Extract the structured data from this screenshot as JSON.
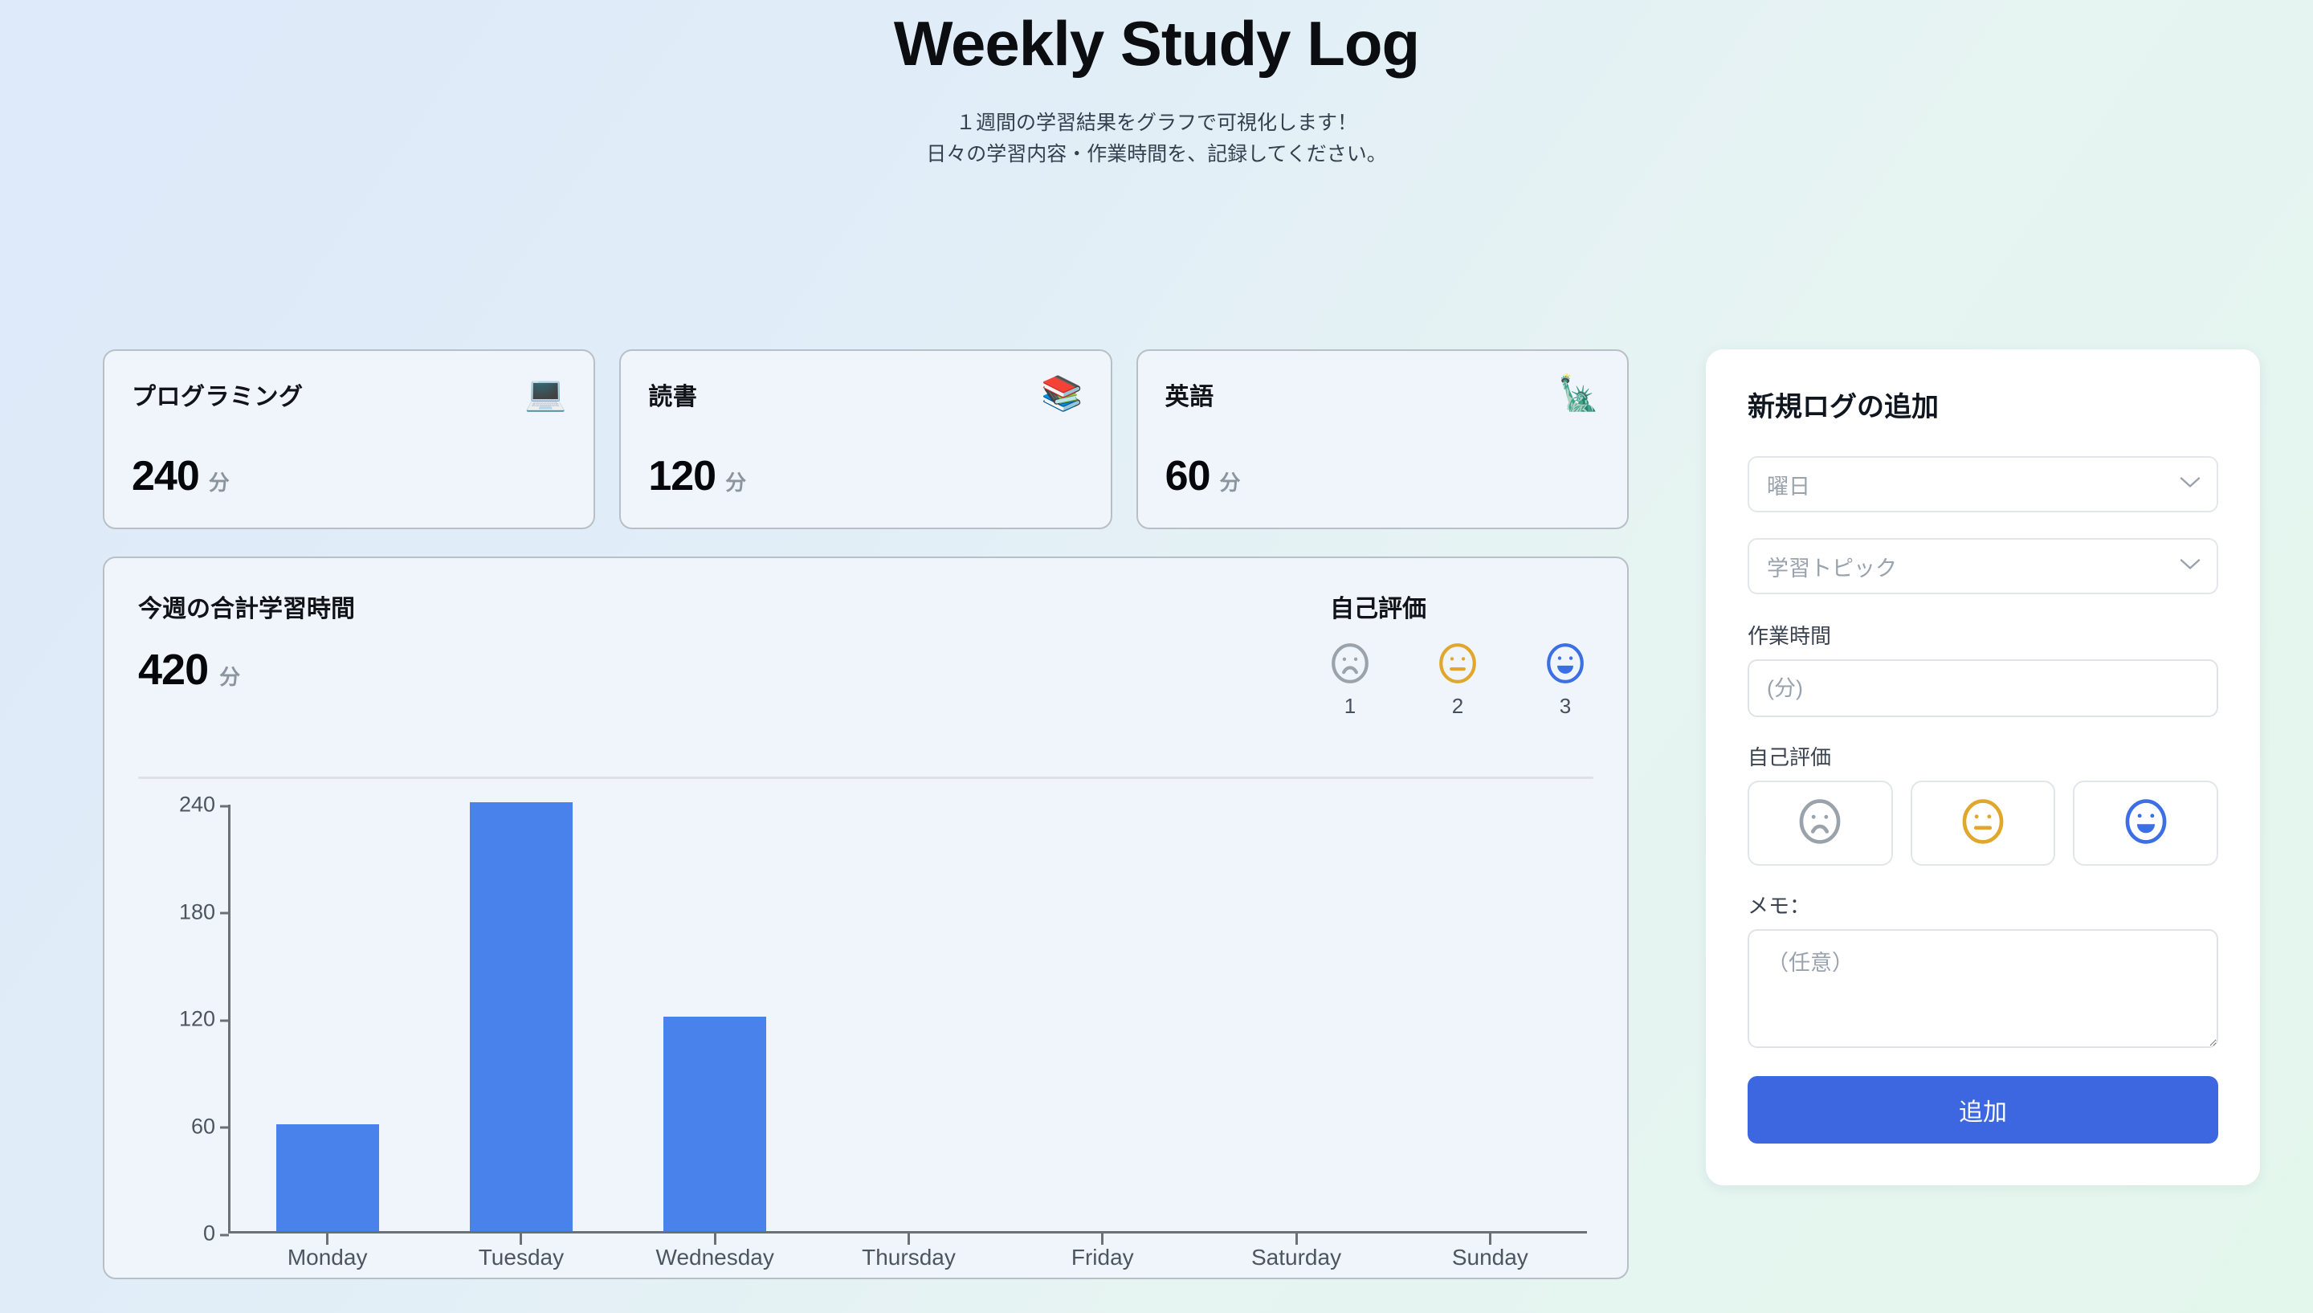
{
  "header": {
    "title": "Weekly Study Log",
    "subtitle_line1": "１週間の学習結果をグラフで可視化します！",
    "subtitle_line2": "日々の学習内容・作業時間を、記録してください。"
  },
  "stats": [
    {
      "label": "プログラミング",
      "emoji": "💻",
      "icon_name": "laptop-emoji",
      "value": "240",
      "unit": "分"
    },
    {
      "label": "読書",
      "emoji": "📚",
      "icon_name": "books-emoji",
      "value": "120",
      "unit": "分"
    },
    {
      "label": "英語",
      "emoji": "🗽",
      "icon_name": "statue-of-liberty-emoji",
      "value": "60",
      "unit": "分"
    }
  ],
  "chart_card": {
    "total_label": "今週の合計学習時間",
    "total_value": "420",
    "total_unit": "分",
    "rating_legend_title": "自己評価",
    "ratings": [
      {
        "num": "1",
        "face": "sad",
        "color": "#9aa2ab"
      },
      {
        "num": "2",
        "face": "neutral",
        "color": "#e0a72c"
      },
      {
        "num": "3",
        "face": "happy",
        "color": "#3c6fe6"
      }
    ]
  },
  "chart_data": {
    "type": "bar",
    "title": "今週の合計学習時間",
    "categories": [
      "Monday",
      "Tuesday",
      "Wednesday",
      "Thursday",
      "Friday",
      "Saturday",
      "Sunday"
    ],
    "values": [
      60,
      240,
      120,
      0,
      0,
      0,
      0
    ],
    "yticks": [
      0,
      60,
      120,
      180,
      240
    ],
    "ylim": [
      0,
      240
    ],
    "xlabel": "",
    "ylabel": "",
    "grid": false,
    "legend": false,
    "bar_color": "#4a82ec"
  },
  "form": {
    "title": "新規ログの追加",
    "day_select": {
      "value": "曜日",
      "icon": "chevron-down-icon"
    },
    "topic_select": {
      "value": "学習トピック",
      "icon": "chevron-down-icon"
    },
    "duration": {
      "label": "作業時間",
      "placeholder": "(分)",
      "value": ""
    },
    "rating": {
      "label": "自己評価",
      "options": [
        {
          "face": "sad",
          "color": "#9aa2ab"
        },
        {
          "face": "neutral",
          "color": "#e0a72c"
        },
        {
          "face": "happy",
          "color": "#3c6fe6"
        }
      ]
    },
    "memo": {
      "label": "メモ：",
      "placeholder": "（任意）",
      "value": ""
    },
    "submit_label": "追加"
  },
  "colors": {
    "accent": "#3c67e0",
    "bar": "#4a82ec",
    "bg_start": "#dee9fa",
    "bg_end": "#e4f7ec",
    "card_bg": "#eff5fa"
  }
}
